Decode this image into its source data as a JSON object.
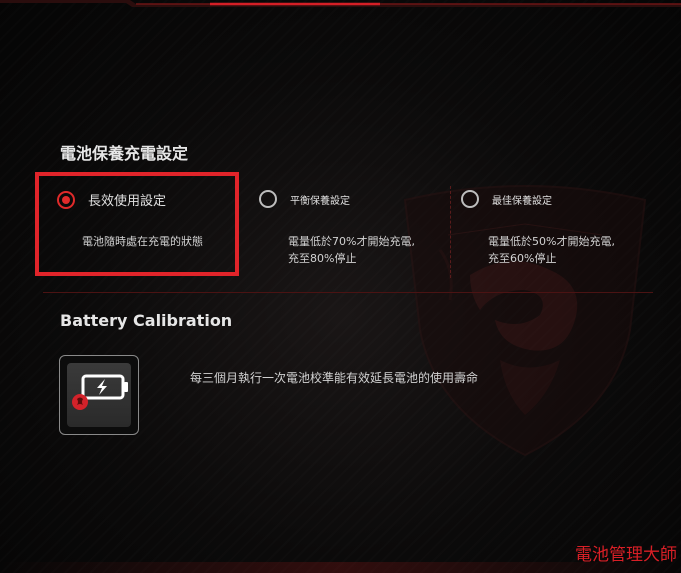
{
  "colors": {
    "accent": "#e02a2a",
    "highlight_border": "#e1242a",
    "background": "#070707",
    "text": "#d8d8d8"
  },
  "charge_section": {
    "title": "電池保養充電設定",
    "options": [
      {
        "label": "長效使用設定",
        "selected": true,
        "description": [
          "電池隨時處在充電的狀態"
        ]
      },
      {
        "label": "平衡保養設定",
        "selected": false,
        "description": [
          "電量低於70%才開始充電,",
          "充至80%停止"
        ]
      },
      {
        "label": "最佳保養設定",
        "selected": false,
        "description": [
          "電量低於50%才開始充電,",
          "充至60%停止"
        ]
      }
    ]
  },
  "calibration": {
    "title": "Battery Calibration",
    "icon": "battery-charging-icon",
    "description": "每三個月執行一次電池校準能有效延長電池的使用壽命"
  },
  "footer": {
    "brand": "電池管理大師"
  }
}
